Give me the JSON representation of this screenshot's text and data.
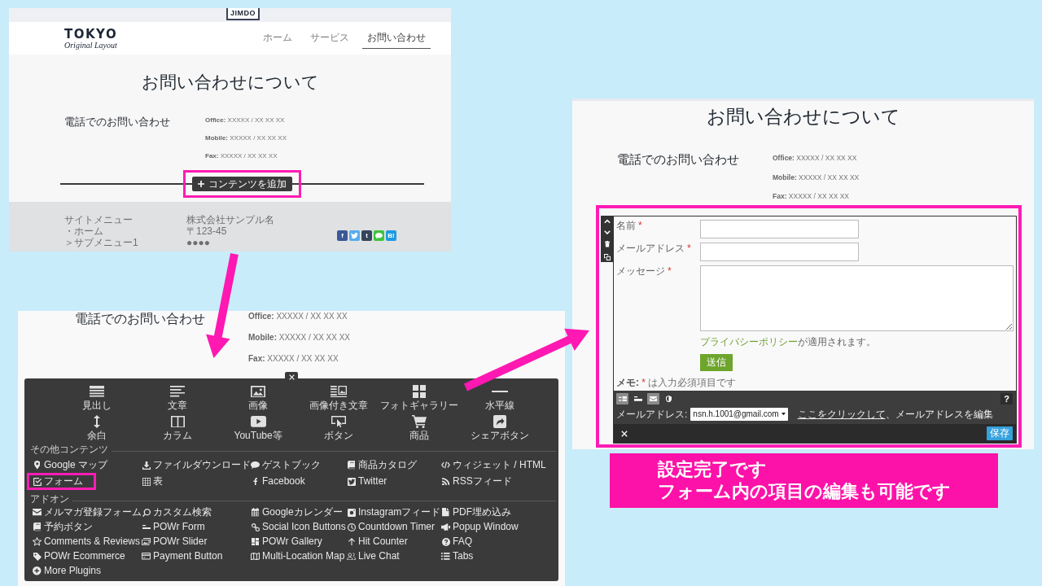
{
  "before_page": {
    "top_bar": {
      "logo": "JIMDO"
    },
    "header": {
      "logo_title": "TOKYO",
      "logo_subtitle": "Original Layout",
      "nav": [
        {
          "label": "ホーム",
          "selected": false
        },
        {
          "label": "サービス",
          "selected": false
        },
        {
          "label": "お問い合わせ",
          "selected": true
        }
      ]
    },
    "title": "お問い合わせについて",
    "section_heading": "電話でのお問い合わせ",
    "contacts": [
      {
        "label": "Office:",
        "value": "XXXXX / XX XX XX"
      },
      {
        "label": "Mobile:",
        "value": "XXXXX / XX XX XX"
      },
      {
        "label": "Fax:",
        "value": "XXXXX / XX XX XX"
      }
    ],
    "add_content_button": {
      "label": "コンテンツを追加",
      "highlighted": true
    },
    "footer": {
      "menu_lines": [
        "サイトメニュー",
        "・ホーム",
        "＞サブメニュー1"
      ],
      "company_lines": [
        "株式会社サンプル名",
        "〒123-45",
        "●●●●"
      ],
      "share_buttons": [
        {
          "kind": "letter",
          "label": "f",
          "color": "#3b5998"
        },
        {
          "kind": "bird",
          "color": "#55acee"
        },
        {
          "kind": "letter",
          "label": "t",
          "color": "#35465c"
        },
        {
          "kind": "bubble",
          "color": "#3cc43c"
        },
        {
          "kind": "letter",
          "label": "B!",
          "color": "#1e9be0"
        }
      ]
    }
  },
  "menu_page": {
    "section_heading": "電話でのお問い合わせ",
    "contacts": [
      {
        "label": "Office:",
        "value": "XXXXX / XX XX XX"
      },
      {
        "label": "Mobile:",
        "value": "XXXXX / XX XX XX"
      },
      {
        "label": "Fax:",
        "value": "XXXXX / XX XX XX"
      }
    ],
    "content_menu": {
      "main_items": [
        "見出し",
        "文章",
        "画像",
        "画像付き文章",
        "フォトギャラリー",
        "水平線",
        "余白",
        "カラム",
        "YouTube等",
        "ボタン",
        "商品",
        "シェアボタン"
      ],
      "sections": [
        {
          "heading": "その他コンテンツ",
          "items": [
            {
              "label": "Google マップ",
              "highlighted": false
            },
            {
              "label": "ファイルダウンロード",
              "highlighted": false
            },
            {
              "label": "ゲストブック",
              "highlighted": false
            },
            {
              "label": "商品カタログ",
              "highlighted": false
            },
            {
              "label": "ウィジェット / HTML",
              "highlighted": false
            },
            {
              "label": "フォーム",
              "highlighted": true
            },
            {
              "label": "表",
              "highlighted": false
            },
            {
              "label": "Facebook",
              "highlighted": false
            },
            {
              "label": "Twitter",
              "highlighted": false
            },
            {
              "label": "RSSフィード",
              "highlighted": false
            }
          ]
        },
        {
          "heading": "アドオン",
          "items": [
            {
              "label": "メルマガ登録フォーム"
            },
            {
              "label": "カスタム検索"
            },
            {
              "label": "Googleカレンダー"
            },
            {
              "label": "Instagramフィード"
            },
            {
              "label": "PDF埋め込み"
            },
            {
              "label": "予約ボタン"
            },
            {
              "label": "POWr Form"
            },
            {
              "label": "Social Icon Buttons"
            },
            {
              "label": "Countdown Timer"
            },
            {
              "label": "Popup Window"
            },
            {
              "label": "Comments & Reviews"
            },
            {
              "label": "POWr Slider"
            },
            {
              "label": "POWr Gallery"
            },
            {
              "label": "Hit Counter"
            },
            {
              "label": "FAQ"
            },
            {
              "label": "POWr Ecommerce"
            },
            {
              "label": "Payment Button"
            },
            {
              "label": "Multi-Location Map"
            },
            {
              "label": "Live Chat"
            },
            {
              "label": "Tabs"
            },
            {
              "label": "More Plugins"
            }
          ]
        }
      ]
    }
  },
  "result_page": {
    "title": "お問い合わせについて",
    "section_heading": "電話でのお問い合わせ",
    "contacts": [
      {
        "label": "Office:",
        "value": "XXXXX / XX XX XX"
      },
      {
        "label": "Mobile:",
        "value": "XXXXX / XX XX XX"
      },
      {
        "label": "Fax:",
        "value": "XXXXX / XX XX XX"
      }
    ],
    "form_editor": {
      "highlighted": true,
      "required_mark": "*",
      "fields": [
        {
          "kind": "text",
          "label": "名前",
          "required": true
        },
        {
          "kind": "text",
          "label": "メールアドレス",
          "required": true
        },
        {
          "kind": "textarea",
          "label": "メッセージ",
          "required": true
        }
      ],
      "privacy": {
        "link": "プライバシーポリシー",
        "text": "が適用されます。"
      },
      "submit": "送信",
      "note": {
        "label": "メモ:",
        "mark": "*",
        "text": "は入力必須項目です"
      },
      "toolbar": {
        "tools": [
          {
            "selected": true
          },
          {
            "selected": false
          },
          {
            "selected": true
          },
          {
            "selected": false
          }
        ],
        "help": "?",
        "email_label": "メールアドレス:",
        "email_value": "nsn.h.1001@gmail.com",
        "edit_link": "ここをクリックして",
        "edit_text": "、メールアドレスを編集"
      },
      "save": "保存"
    }
  },
  "caption": {
    "lines": [
      "設定完了です",
      "フォーム内の項目の編集も可能です"
    ]
  }
}
